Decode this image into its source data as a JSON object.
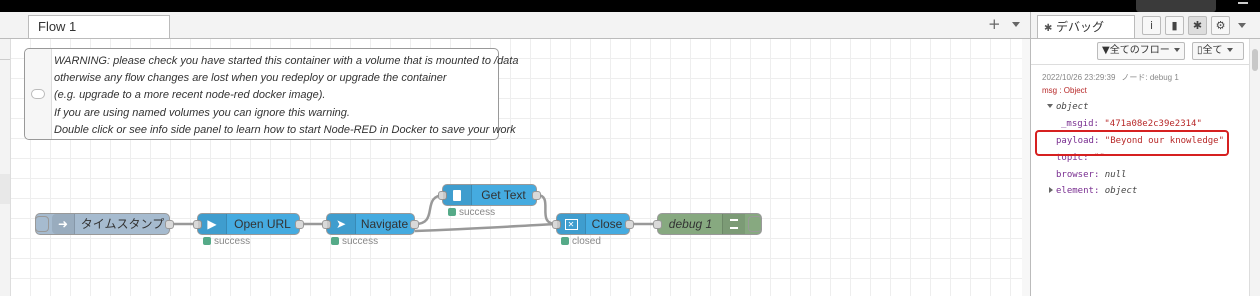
{
  "workspace": {
    "tab_label": "Flow 1",
    "add_tab_glyph": "+"
  },
  "comment": {
    "lines": [
      "WARNING: please check you have started this container with a volume that is mounted to /data",
      "otherwise any flow changes are lost when you redeploy or upgrade the container",
      "(e.g. upgrade to a more recent node-red docker image).",
      "If you are using named volumes you can ignore this warning.",
      "Double click or see info side panel to learn how to start Node-RED in Docker to save your work"
    ]
  },
  "nodes": {
    "inject": {
      "label": "タイムスタンプ",
      "color": "#a6bbcf"
    },
    "open_url": {
      "label": "Open URL",
      "color": "#3fadb5",
      "status": "success"
    },
    "navigate": {
      "label": "Navigate",
      "color": "#3fadb5",
      "status": "success"
    },
    "get_text": {
      "label": "Get Text",
      "color": "#3fadb5",
      "status": "success"
    },
    "close": {
      "label": "Close",
      "color": "#3fadb5",
      "status": "closed"
    },
    "debug": {
      "label": "debug 1",
      "color": "#87a980"
    }
  },
  "sidebar": {
    "tab_label": "デバッグ",
    "filter_flows_label": "全てのフロー",
    "filter_all_label": "全て",
    "message": {
      "timestamp": "2022/10/26 23:29:39",
      "node_label": "ノード: debug 1",
      "msg_type": "msg : Object",
      "root": "object",
      "fields": [
        {
          "key": "_msgid",
          "value": "\"471a08e2c39e2314\"",
          "kind": "string"
        },
        {
          "key": "payload",
          "value": "\"Beyond our knowledge\"",
          "kind": "string"
        },
        {
          "key": "topic",
          "value": "\"\"",
          "kind": "string"
        },
        {
          "key": "browser",
          "value": "null",
          "kind": "null"
        },
        {
          "key": "element",
          "value": "object",
          "kind": "object"
        }
      ]
    }
  },
  "colors": {
    "node_blue": "#3fadb5",
    "node_inject": "#a6bbcf",
    "node_debug": "#87a980",
    "highlight_red": "#d62020",
    "status_green": "#55aa88"
  }
}
